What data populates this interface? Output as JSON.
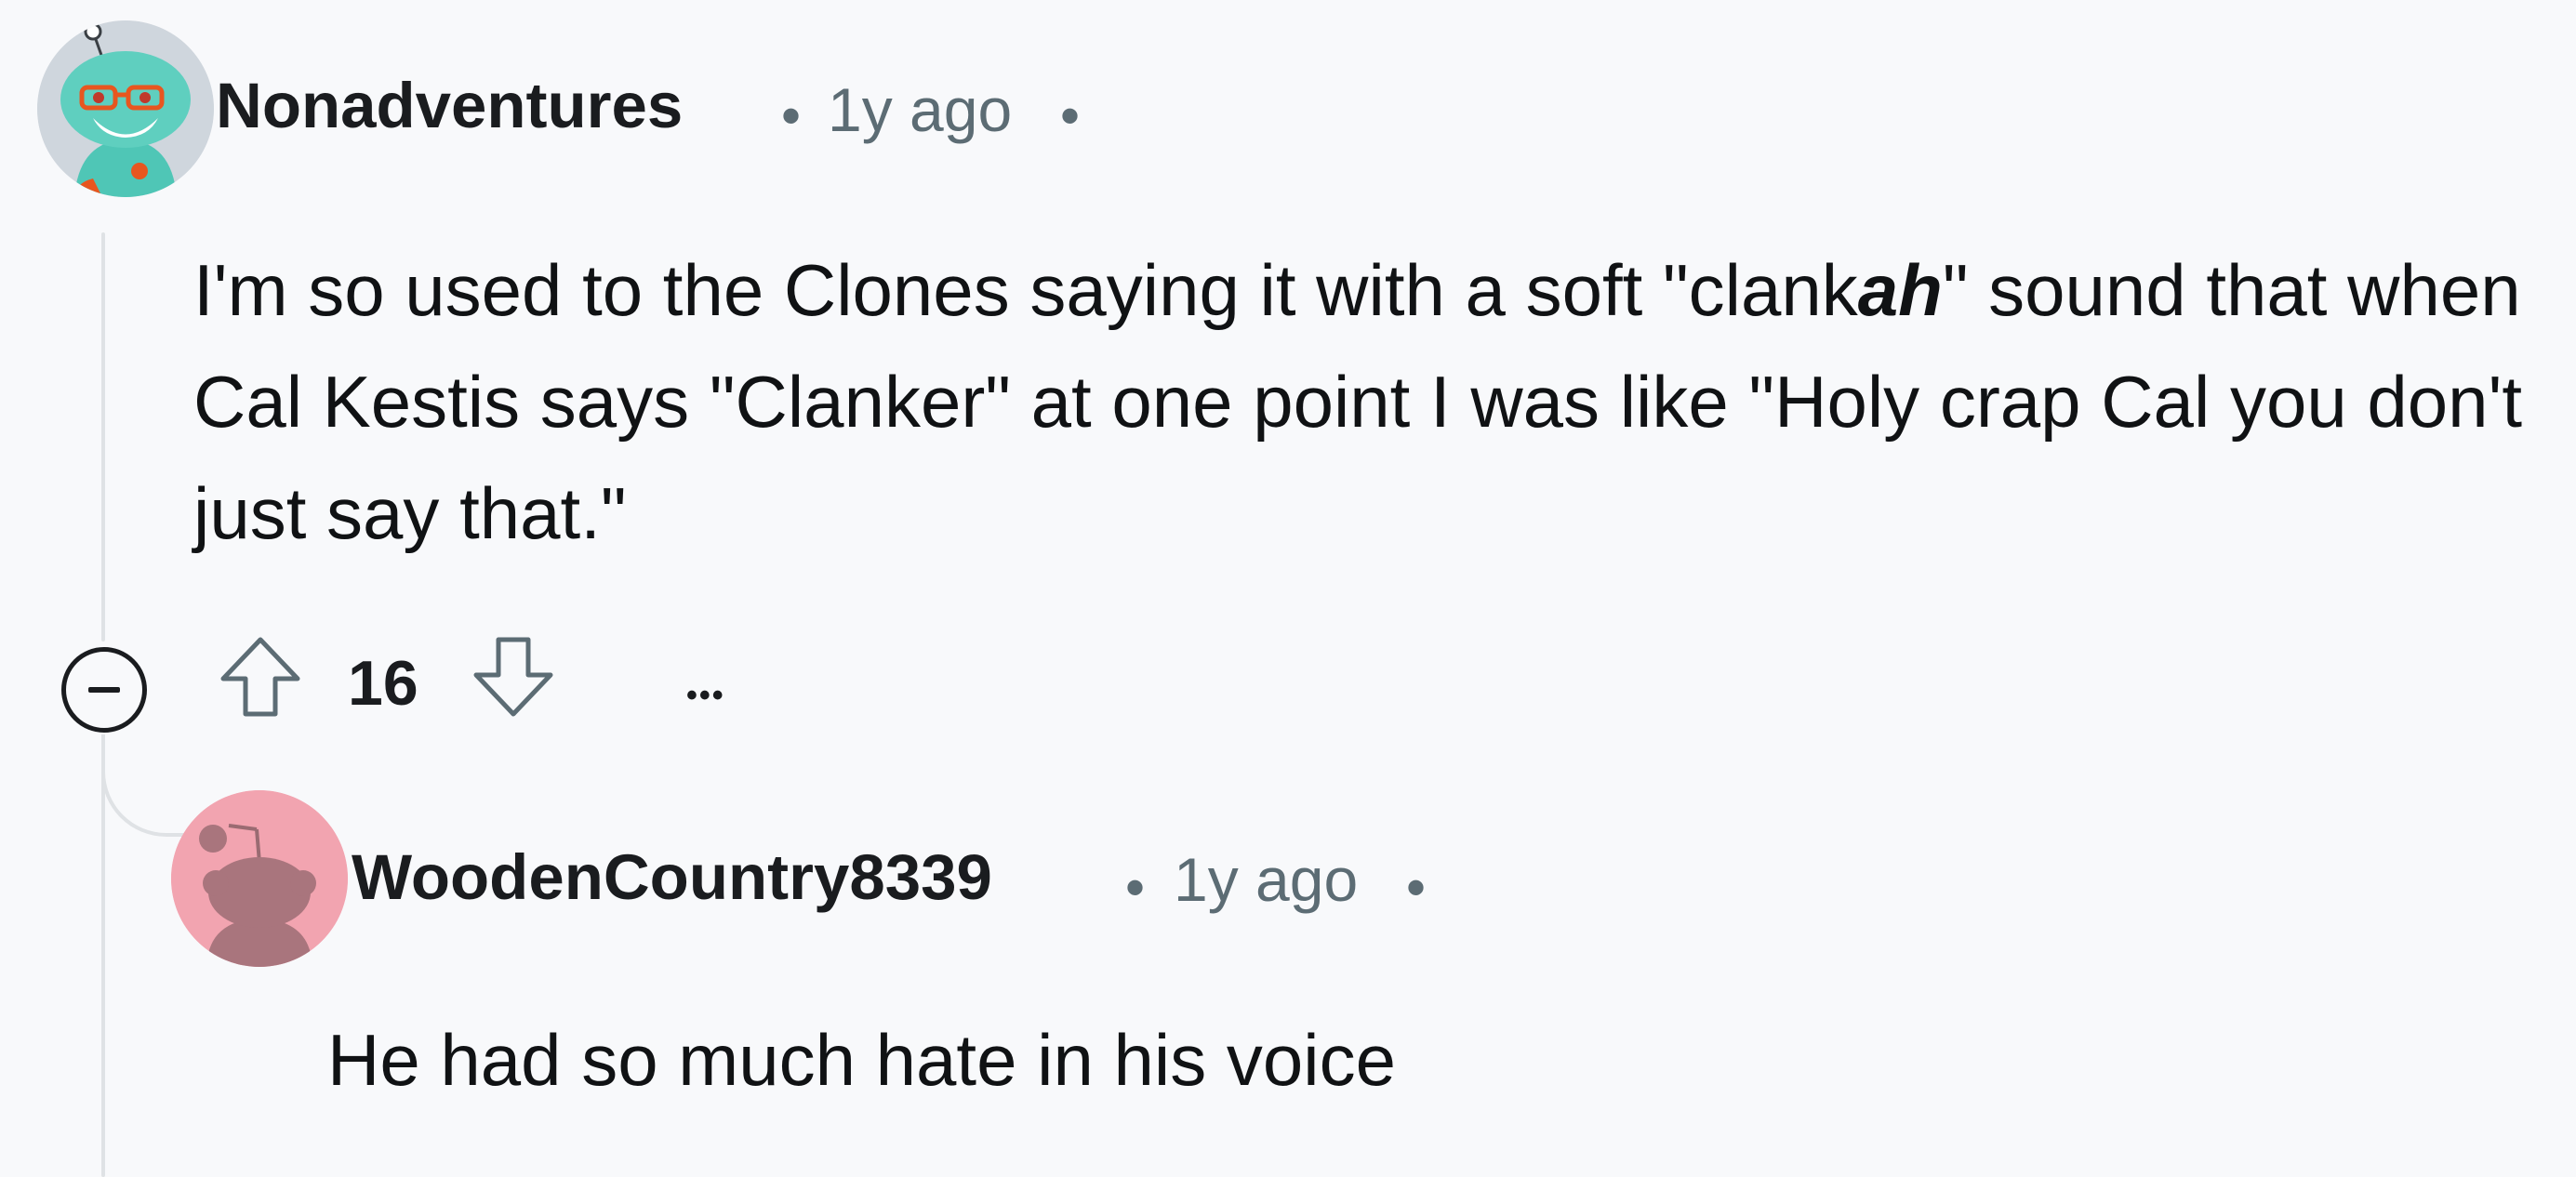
{
  "comment": {
    "username": "Nonadventures",
    "time": "1y ago",
    "sep_dot": "•",
    "body_before": "I'm so used to the Clones saying it with a soft \"clank",
    "body_emph": "ah",
    "body_after": "\" sound that when Cal Kestis says \"Clanker\" at one point I was like \"Holy crap Cal you don't just say that.\"",
    "vote_count": "16",
    "more_label": "•••"
  },
  "reply": {
    "username": "WoodenCountry8339",
    "time": "1y ago",
    "sep_dot": "•",
    "body": "He had so much hate in his voice"
  },
  "icons": {
    "collapse": "minus-circle-icon",
    "upvote": "arrow-up-outline-icon",
    "downvote": "arrow-down-outline-icon",
    "more": "ellipsis-icon"
  },
  "colors": {
    "background": "#f8f9fb",
    "thread_line": "#dfe2e5",
    "meta_text": "#5c6c74",
    "reply_avatar_bg": "#f2a4b0"
  }
}
